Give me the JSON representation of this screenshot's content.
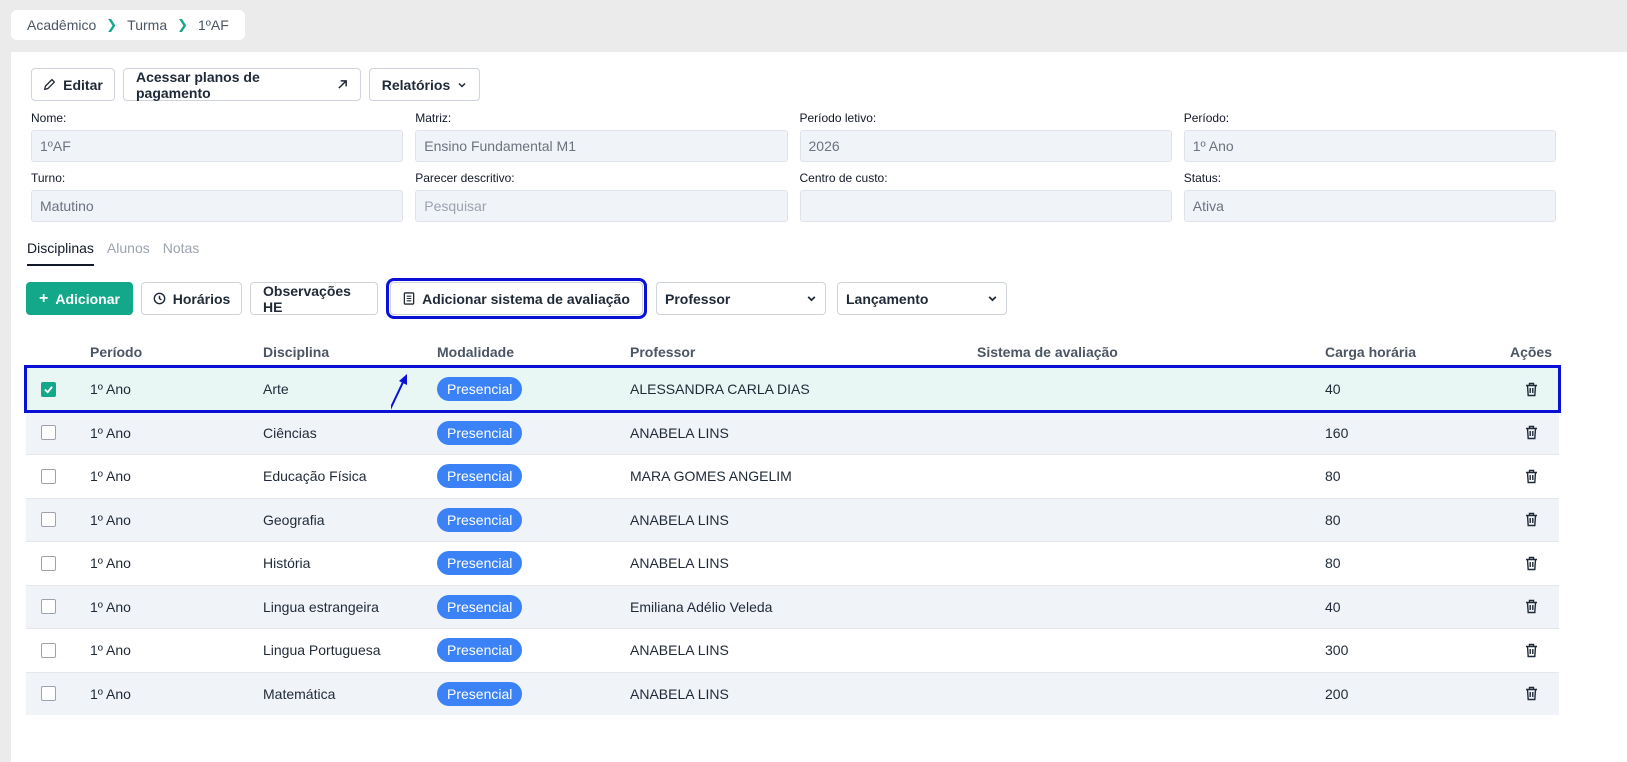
{
  "breadcrumb": [
    "Acadêmico",
    "Turma",
    "1ºAF"
  ],
  "toolbar": {
    "edit_label": "Editar",
    "payment_plans_label": "Acessar planos de pagamento",
    "reports_label": "Relatórios"
  },
  "fields": [
    {
      "label": "Nome:",
      "value": "1ºAF"
    },
    {
      "label": "Matriz:",
      "value": "Ensino Fundamental M1"
    },
    {
      "label": "Período letivo:",
      "value": "2026"
    },
    {
      "label": "Período:",
      "value": "1º Ano"
    },
    {
      "label": "Turno:",
      "value": "Matutino"
    },
    {
      "label": "Parecer descritivo:",
      "placeholder": "Pesquisar"
    },
    {
      "label": "Centro de custo:",
      "value": ""
    },
    {
      "label": "Status:",
      "value": "Ativa"
    }
  ],
  "tabs": [
    "Disciplinas",
    "Alunos",
    "Notas"
  ],
  "actions": {
    "add_label": "Adicionar",
    "schedules_label": "Horários",
    "notes_label": "Observações HE",
    "add_eval_label": "Adicionar sistema de avaliação",
    "professor_select": "Professor",
    "launch_select": "Lançamento"
  },
  "table": {
    "headers": [
      "Período",
      "Disciplina",
      "Modalidade",
      "Professor",
      "Sistema de avaliação",
      "Carga horária",
      "Ações"
    ],
    "rows": [
      {
        "periodo": "1º Ano",
        "disciplina": "Arte",
        "modalidade": "Presencial",
        "professor": "ALESSANDRA CARLA DIAS",
        "sistema": "",
        "carga": "40",
        "checked": true
      },
      {
        "periodo": "1º Ano",
        "disciplina": "Ciências",
        "modalidade": "Presencial",
        "professor": "ANABELA LINS",
        "sistema": "",
        "carga": "160",
        "checked": false
      },
      {
        "periodo": "1º Ano",
        "disciplina": "Educação Física",
        "modalidade": "Presencial",
        "professor": "MARA GOMES ANGELIM",
        "sistema": "",
        "carga": "80",
        "checked": false
      },
      {
        "periodo": "1º Ano",
        "disciplina": "Geografia",
        "modalidade": "Presencial",
        "professor": "ANABELA LINS",
        "sistema": "",
        "carga": "80",
        "checked": false
      },
      {
        "periodo": "1º Ano",
        "disciplina": "História",
        "modalidade": "Presencial",
        "professor": "ANABELA LINS",
        "sistema": "",
        "carga": "80",
        "checked": false
      },
      {
        "periodo": "1º Ano",
        "disciplina": "Lingua estrangeira",
        "modalidade": "Presencial",
        "professor": "Emiliana Adélio Veleda",
        "sistema": "",
        "carga": "40",
        "checked": false
      },
      {
        "periodo": "1º Ano",
        "disciplina": "Lingua Portuguesa",
        "modalidade": "Presencial",
        "professor": "ANABELA LINS",
        "sistema": "",
        "carga": "300",
        "checked": false
      },
      {
        "periodo": "1º Ano",
        "disciplina": "Matemática",
        "modalidade": "Presencial",
        "professor": "ANABELA LINS",
        "sistema": "",
        "carga": "200",
        "checked": false
      }
    ]
  },
  "colors": {
    "accent": "#14a88a",
    "badge": "#3b82f6",
    "annotation": "#0b10d6"
  }
}
